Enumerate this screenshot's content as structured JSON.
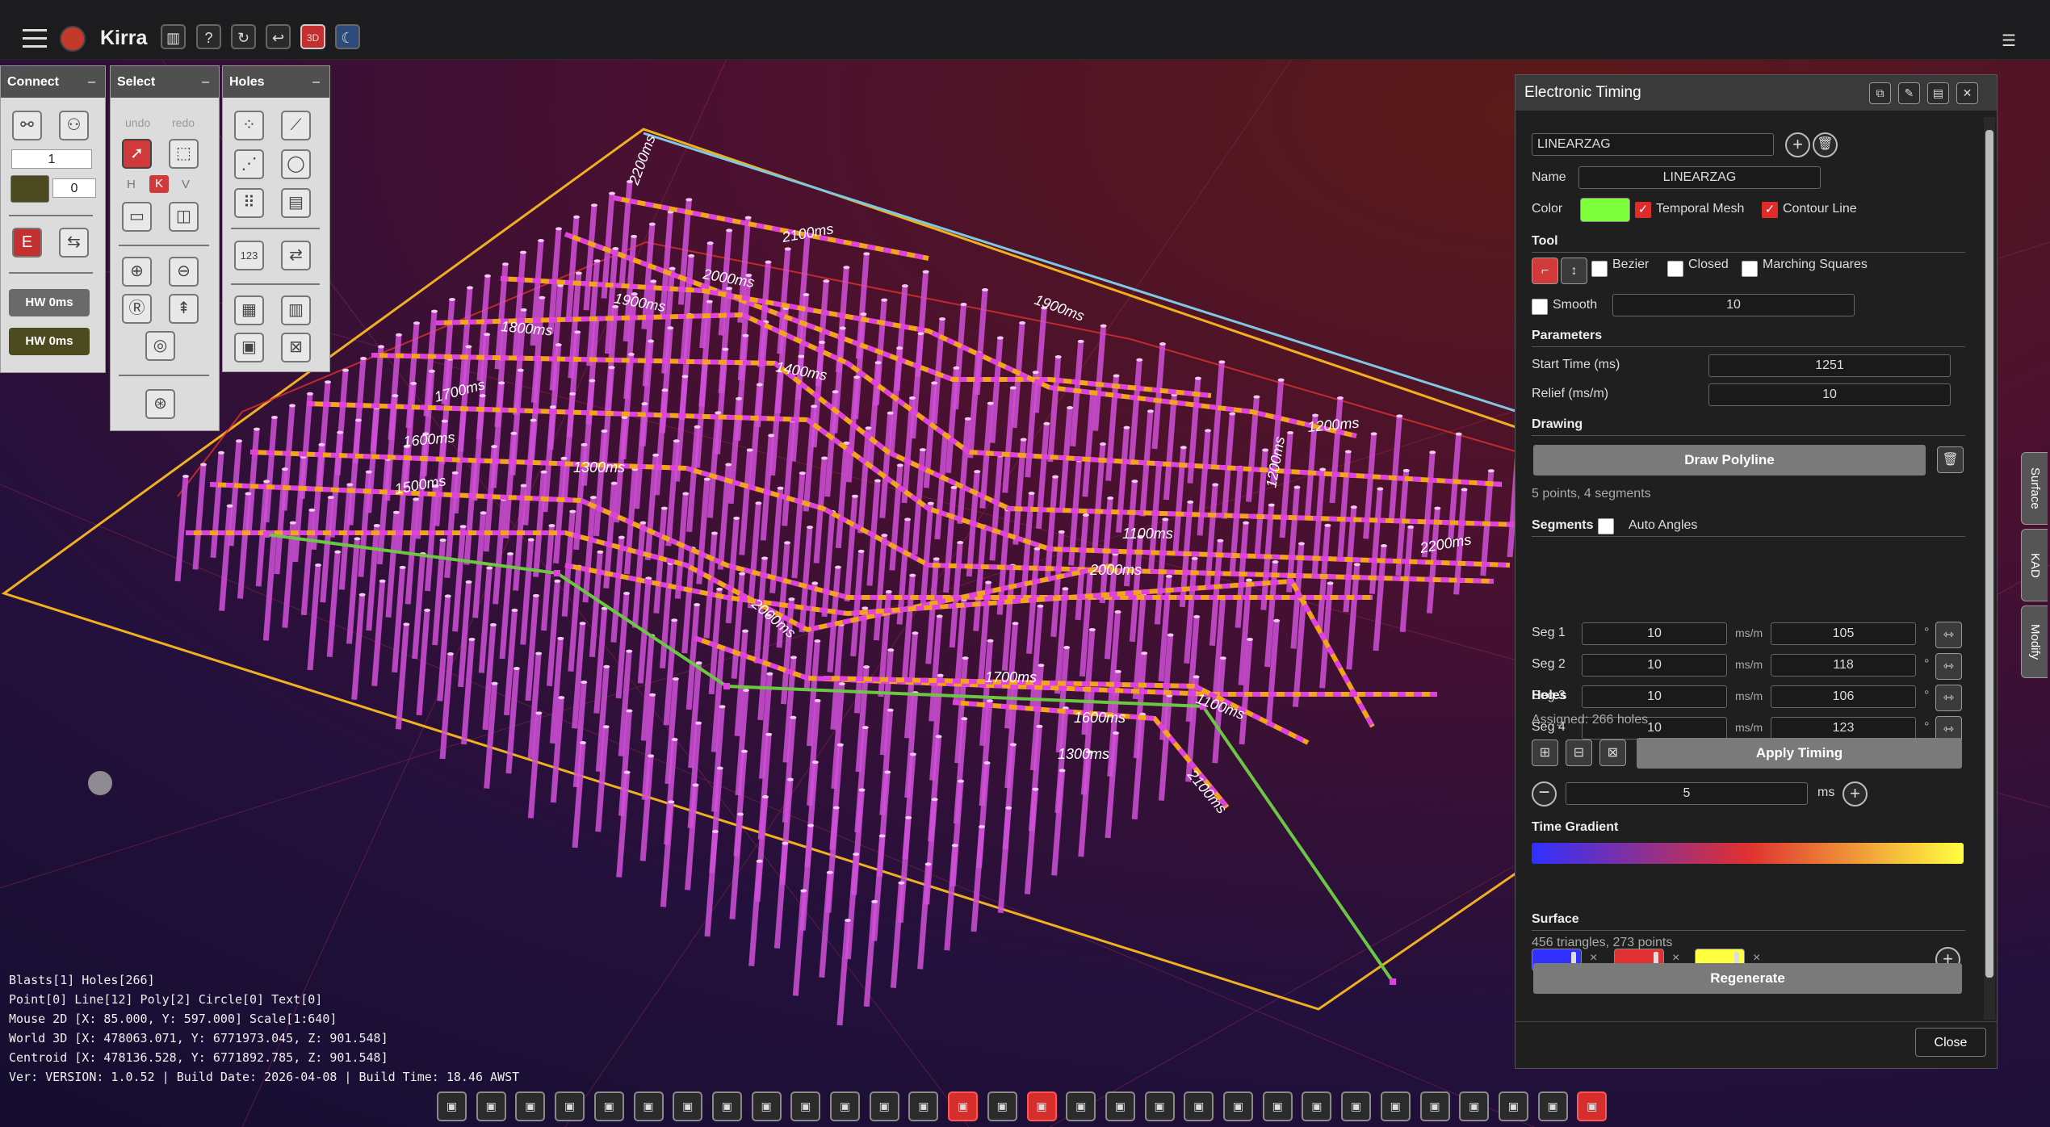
{
  "app": {
    "name": "Kirra"
  },
  "toolbar": {
    "icons": [
      "book-icon",
      "help-icon",
      "refresh-icon",
      "undo-icon",
      "3d-toggle-icon",
      "moon-icon"
    ],
    "right_icon": "list-icon"
  },
  "connect_panel": {
    "title": "Connect",
    "input1": "1",
    "input2": "0",
    "hw1": "HW 0ms",
    "hw2": "HW 0ms",
    "e_label": "E"
  },
  "select_panel": {
    "title": "Select",
    "undo": "undo",
    "redo": "redo",
    "h": "H",
    "k": "K",
    "v": "V"
  },
  "holes_panel": {
    "title": "Holes",
    "numbers_label": "123"
  },
  "status": {
    "line1": "Blasts[1] Holes[266]",
    "line2": "Point[0] Line[12] Poly[2] Circle[0] Text[0]",
    "line3": "Mouse 2D [X: 85.000, Y: 597.000] Scale[1:640]",
    "line4": "World 3D [X: 478063.071, Y: 6771973.045, Z: 901.548]",
    "line5": "Centroid [X: 478136.528, Y: 6771892.785, Z: 901.548]",
    "line6": "Ver: VERSION: 1.0.52 | Build Date: 2026-04-08 | Build Time: 18.46 AWST"
  },
  "scene": {
    "contour_labels": [
      "2200ms",
      "2100ms",
      "2000ms",
      "1900ms",
      "1800ms",
      "1700ms",
      "1600ms",
      "1500ms",
      "1400ms",
      "1300ms",
      "1200ms",
      "1100ms",
      "2000ms",
      "1700ms",
      "1600ms",
      "1300ms",
      "1200ms",
      "1100ms"
    ],
    "colors": {
      "contour_orange": "#f2a51a",
      "contour_pink": "#e040e0",
      "hole_pink": "#d050d8",
      "polyline_green": "#6cc644",
      "boundary_yellow": "#f0b020",
      "boundary_cyan": "#7ec8e3"
    }
  },
  "timing": {
    "title": "Electronic Timing",
    "select_value": "LINEARZAG",
    "name_label": "Name",
    "name_value": "LINEARZAG",
    "color_label": "Color",
    "color_value": "#7cff3a",
    "temporal_mesh": "Temporal Mesh",
    "contour_line": "Contour Line",
    "tool_label": "Tool",
    "bezier": "Bezier",
    "closed": "Closed",
    "marching": "Marching Squares",
    "smooth": "Smooth",
    "smooth_value": "10",
    "params_label": "Parameters",
    "start_label": "Start Time (ms)",
    "start_value": "1251",
    "relief_label": "Relief (ms/m)",
    "relief_value": "10",
    "drawing_label": "Drawing",
    "draw_btn": "Draw Polyline",
    "points_info": "5 points, 4 segments",
    "segments_label": "Segments",
    "auto_angles": "Auto Angles",
    "unit": "ms/m",
    "deg": "°",
    "segments": [
      {
        "label": "Seg 1",
        "relief": "10",
        "angle": "105"
      },
      {
        "label": "Seg 2",
        "relief": "10",
        "angle": "118"
      },
      {
        "label": "Seg 3",
        "relief": "10",
        "angle": "106"
      },
      {
        "label": "Seg 4",
        "relief": "10",
        "angle": "123"
      }
    ],
    "holes_label": "Holes",
    "assigned": "Assigned: 266 holes",
    "apply_btn": "Apply Timing",
    "step_value": "5",
    "step_unit": "ms",
    "gradient_label": "Time Gradient",
    "gradient_colors": [
      "#3030ff",
      "#e03030",
      "#ffff40"
    ],
    "x_mark": "×",
    "surface_label": "Surface",
    "surface_info": "456 triangles, 273 points",
    "regen_btn": "Regenerate",
    "close_btn": "Close"
  },
  "side_tabs": [
    "Surface",
    "KAD",
    "Modify"
  ]
}
